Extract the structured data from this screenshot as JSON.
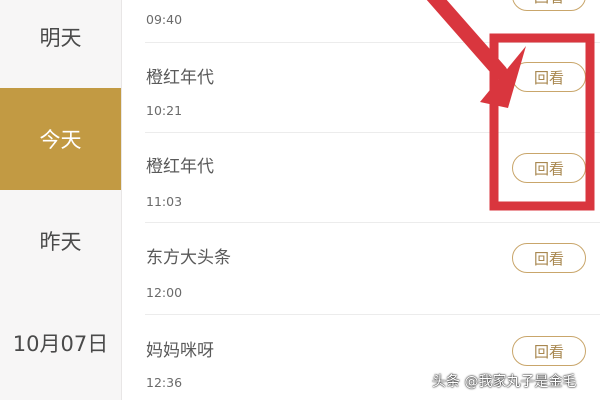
{
  "sidebar": {
    "days": [
      {
        "label": "明天",
        "active": false
      },
      {
        "label": "今天",
        "active": true
      },
      {
        "label": "昨天",
        "active": false
      },
      {
        "label": "10月07日",
        "active": false
      }
    ]
  },
  "programs": [
    {
      "title": "",
      "time": "09:40",
      "action": "回看"
    },
    {
      "title": "橙红年代",
      "time": "10:21",
      "action": "回看"
    },
    {
      "title": "橙红年代",
      "time": "11:03",
      "action": "回看"
    },
    {
      "title": "东方大头条",
      "time": "12:00",
      "action": "回看"
    },
    {
      "title": "妈妈咪呀",
      "time": "12:36",
      "action": "回看"
    }
  ],
  "watermark": "头条 @我家丸子是金毛",
  "colors": {
    "accent": "#c29a43",
    "annotation_red": "#d9363e",
    "button_border": "#c9a66b"
  }
}
